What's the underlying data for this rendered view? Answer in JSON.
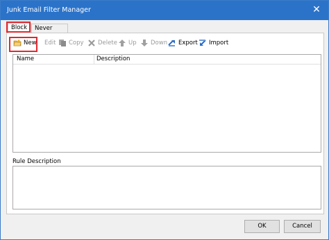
{
  "window": {
    "title": "Junk Email Filter Manager",
    "close_glyph": "✕"
  },
  "tabs": [
    {
      "label": "Block",
      "active": true
    },
    {
      "label": "Never Block",
      "active": false
    }
  ],
  "toolbar": {
    "new_label": "New",
    "edit_label": "Edit",
    "copy_label": "Copy",
    "delete_label": "Delete",
    "up_label": "Up",
    "down_label": "Down",
    "export_label": "Export",
    "import_label": "Import"
  },
  "list": {
    "columns": [
      "Name",
      "Description"
    ],
    "rows": []
  },
  "rule_description": {
    "label": "Rule Description",
    "text": ""
  },
  "buttons": {
    "ok_label": "OK",
    "cancel_label": "Cancel"
  },
  "colors": {
    "titlebar": "#2b73c9",
    "highlight": "#e0282e",
    "disabled_text": "#9a9a9a",
    "accent_icon": "#2b6cc4"
  }
}
